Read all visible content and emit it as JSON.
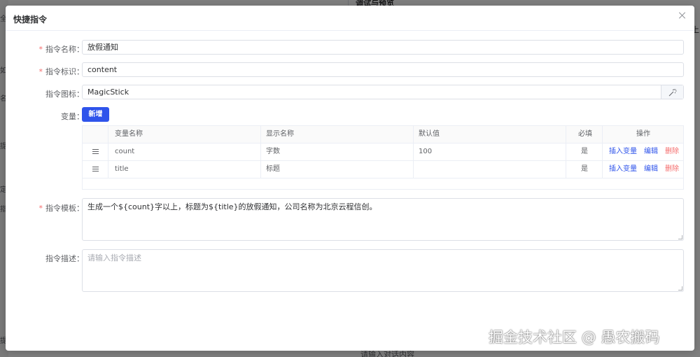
{
  "background": {
    "panel_title": "调试与预览",
    "right_tag": "上",
    "bottom_placeholder": "请输入对话内容",
    "side_chars": [
      "全",
      "如",
      "名",
      "提",
      "定",
      "指",
      "提"
    ]
  },
  "dialog": {
    "title": "快捷指令",
    "close_icon": "close-icon"
  },
  "form": {
    "name": {
      "label": "指令名称：",
      "required": "*",
      "value": "放假通知"
    },
    "identifier": {
      "label": "指令标识：",
      "required": "*",
      "value": "content"
    },
    "icon": {
      "label": "指令图标：",
      "value": "MagicStick",
      "icon_name": "magic-stick-icon"
    },
    "variables": {
      "label": "变量：",
      "add_button": "新增",
      "columns": [
        "变量名称",
        "显示名称",
        "默认值",
        "必填",
        "操作"
      ],
      "rows": [
        {
          "name": "count",
          "display": "字数",
          "default": "100",
          "required": "是"
        },
        {
          "name": "title",
          "display": "标题",
          "default": "",
          "required": "是"
        }
      ],
      "actions": {
        "insert": "插入变量",
        "edit": "编辑",
        "delete": "删除"
      }
    },
    "template": {
      "label": "指令模板：",
      "required": "*",
      "value": "生成一个${count}字以上，标题为${title}的放假通知，公司名称为北京云程信创。"
    },
    "description": {
      "label": "指令描述：",
      "placeholder": "请输入指令描述"
    }
  },
  "watermark": "掘金技术社区 @ 愚农搬码",
  "colors": {
    "primary": "#2f54eb",
    "danger": "#f56c6c",
    "required": "#f56c6c"
  }
}
